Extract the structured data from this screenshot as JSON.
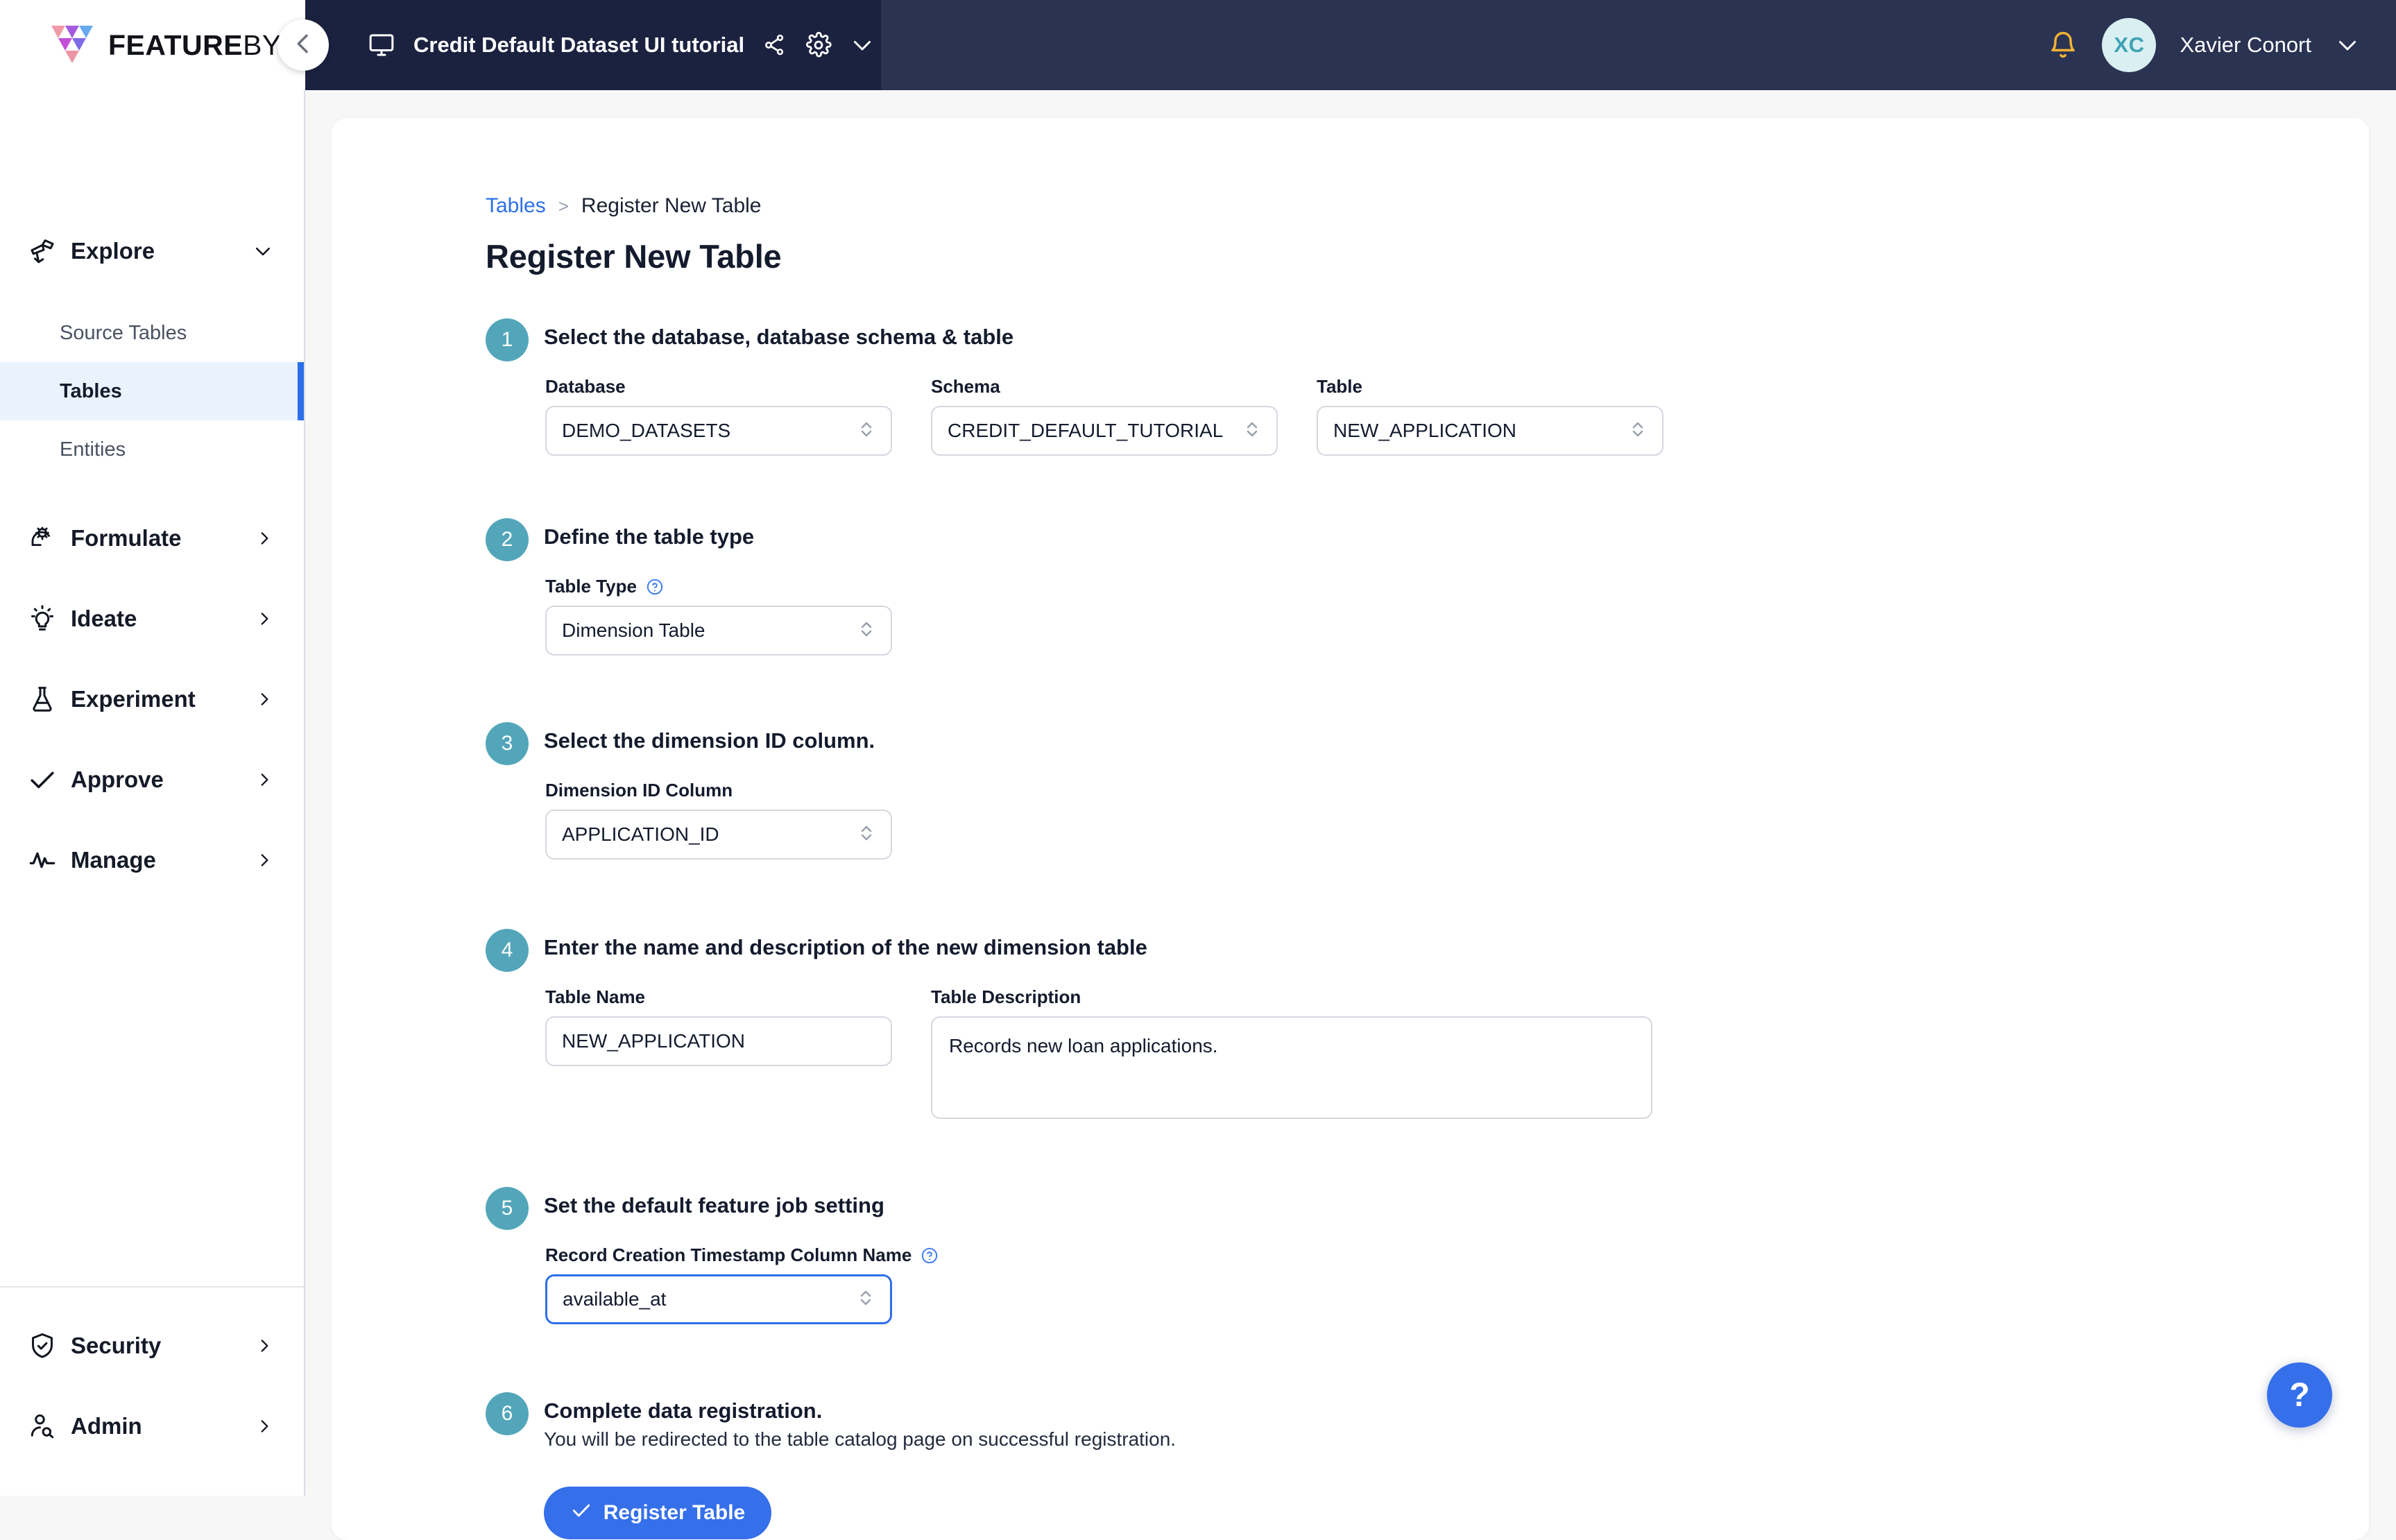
{
  "brand": {
    "word_bold": "FEATURE",
    "word_light": "BYTE",
    "logo_icon": "featurebyte-logo-icon"
  },
  "topbar": {
    "collapse_icon": "chevron-left-icon",
    "workspace_icon": "monitor-icon",
    "workspace_title": "Credit Default Dataset UI tutorial",
    "share_icon": "share-nodes-icon",
    "settings_icon": "gear-icon",
    "more_icon": "chevron-down-icon",
    "notifications_icon": "bell-icon",
    "avatar_initials": "XC",
    "user_name": "Xavier Conort",
    "user_menu_icon": "chevron-down-icon"
  },
  "sidebar": {
    "groups": [
      {
        "label": "Explore",
        "icon": "telescope-icon",
        "chevron": "chevron-down-icon",
        "expanded": true
      },
      {
        "label": "Formulate",
        "icon": "brain-gear-icon",
        "chevron": "chevron-right-icon",
        "expanded": false
      },
      {
        "label": "Ideate",
        "icon": "lightbulb-icon",
        "chevron": "chevron-right-icon",
        "expanded": false
      },
      {
        "label": "Experiment",
        "icon": "flask-icon",
        "chevron": "chevron-right-icon",
        "expanded": false
      },
      {
        "label": "Approve",
        "icon": "check-icon",
        "chevron": "chevron-right-icon",
        "expanded": false
      },
      {
        "label": "Manage",
        "icon": "activity-pulse-icon",
        "chevron": "chevron-right-icon",
        "expanded": false
      }
    ],
    "explore_items": [
      {
        "label": "Source Tables",
        "active": false
      },
      {
        "label": "Tables",
        "active": true
      },
      {
        "label": "Entities",
        "active": false
      }
    ],
    "bottom": [
      {
        "label": "Security",
        "icon": "shield-check-icon",
        "chevron": "chevron-right-icon"
      },
      {
        "label": "Admin",
        "icon": "user-search-icon",
        "chevron": "chevron-right-icon"
      }
    ]
  },
  "breadcrumb": {
    "parent": "Tables",
    "separator": ">",
    "current": "Register New Table"
  },
  "page": {
    "title": "Register New Table"
  },
  "steps": {
    "one": {
      "number": "1",
      "heading": "Select the database, database schema & table",
      "database_label": "Database",
      "database_value": "DEMO_DATASETS",
      "schema_label": "Schema",
      "schema_value": "CREDIT_DEFAULT_TUTORIAL",
      "table_label": "Table",
      "table_value": "NEW_APPLICATION"
    },
    "two": {
      "number": "2",
      "heading": "Define the table type",
      "table_type_label": "Table Type",
      "table_type_value": "Dimension Table"
    },
    "three": {
      "number": "3",
      "heading": "Select the dimension ID column.",
      "dimension_id_label": "Dimension ID Column",
      "dimension_id_value": "APPLICATION_ID"
    },
    "four": {
      "number": "4",
      "heading": "Enter the name and description of the new dimension table",
      "table_name_label": "Table Name",
      "table_name_value": "NEW_APPLICATION",
      "table_desc_label": "Table Description",
      "table_desc_value": "Records new loan applications."
    },
    "five": {
      "number": "5",
      "heading": "Set the default feature job setting",
      "record_ts_label": "Record Creation Timestamp Column Name",
      "record_ts_value": "available_at"
    },
    "six": {
      "number": "6",
      "heading": "Complete data registration.",
      "subtext": "You will be redirected to the table catalog page on successful registration.",
      "button_label": "Register Table",
      "button_icon": "check-icon"
    }
  },
  "help_fab": {
    "label": "?",
    "icon": "question-mark-icon"
  },
  "colors": {
    "header_navy": "#2A3352",
    "tab_navy": "#1B2240",
    "accent_blue": "#356FEA",
    "step_teal": "#53A6BA",
    "active_nav_bg": "#EAF3FD",
    "active_nav_bar": "#2C6FE8",
    "page_bg": "#F7F7F8",
    "bell_yellow": "#F2B233",
    "avatar_bg": "#D9F0F2",
    "avatar_text": "#3FA3B3"
  }
}
